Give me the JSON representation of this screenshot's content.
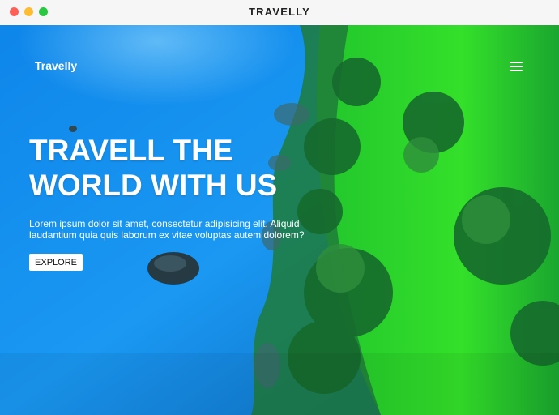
{
  "window": {
    "title": "TRAVELLY"
  },
  "nav": {
    "brand": "Travelly",
    "menu_icon": "hamburger-menu-icon"
  },
  "hero": {
    "headline_line1": "TRAVELL THE",
    "headline_line2": "WORLD WITH US",
    "subtext": "Lorem ipsum dolor sit amet, consectetur adipisicing elit. Aliquid laudantium quia quis laborum ex vitae voluptas autem dolorem?",
    "button_label": "EXPLORE"
  },
  "colors": {
    "ocean": "#1a8ef0",
    "forest": "#1f7a2e",
    "grass": "#2fd12a",
    "text": "#ffffff",
    "button_bg": "#ffffff"
  }
}
